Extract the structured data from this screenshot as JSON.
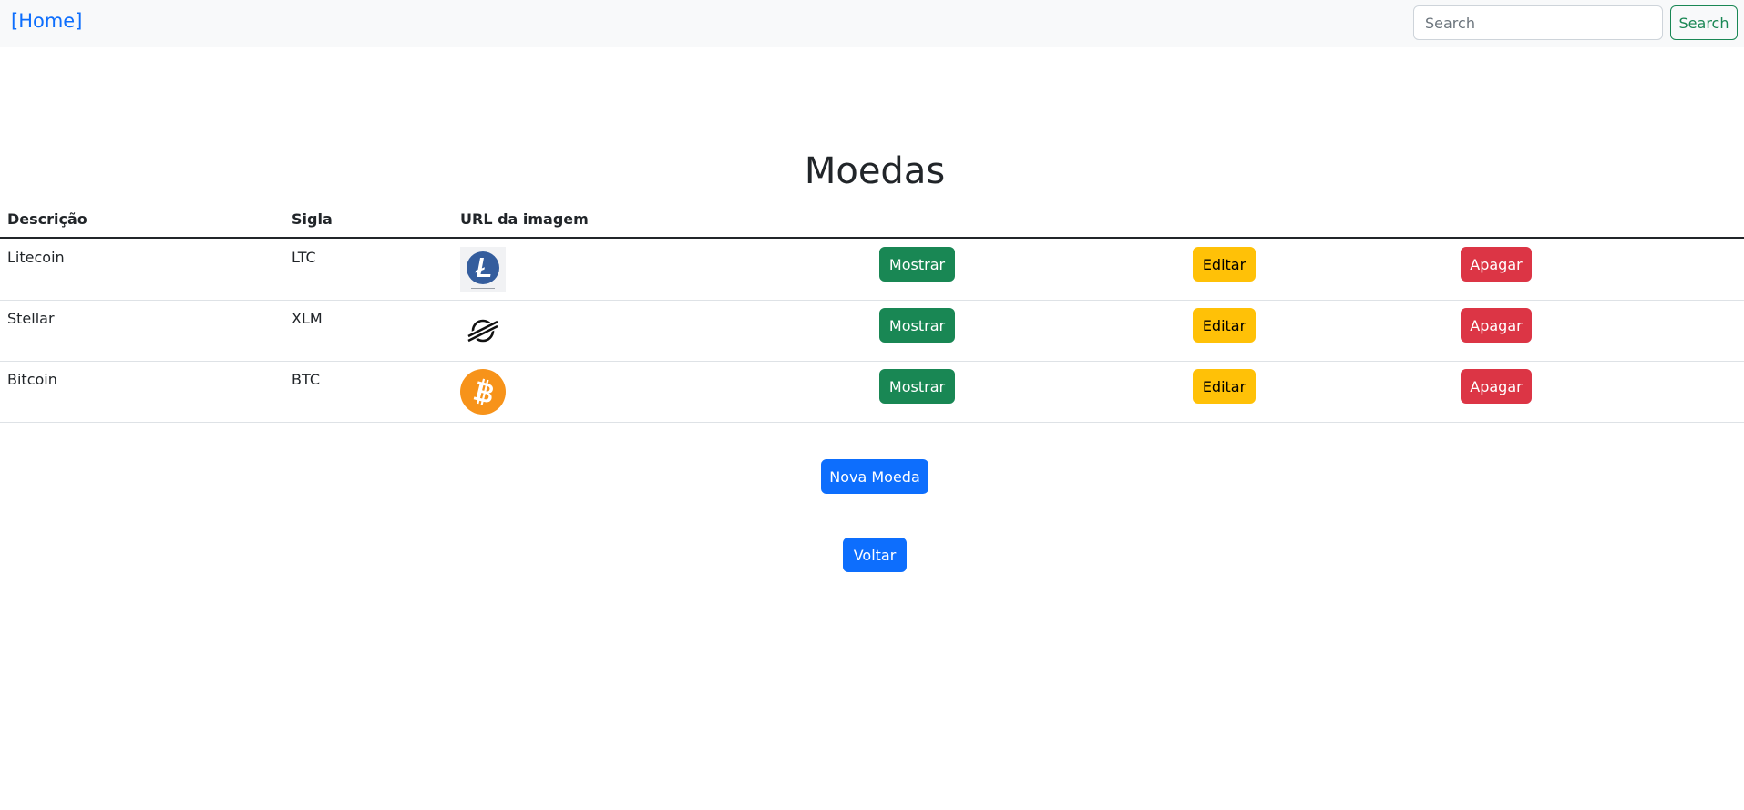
{
  "navbar": {
    "brand": "[Home]",
    "search_placeholder": "Search",
    "search_button": "Search"
  },
  "page": {
    "title": "Moedas"
  },
  "table": {
    "headers": [
      "Descrição",
      "Sigla",
      "URL da imagem"
    ],
    "rows": [
      {
        "descricao": "Litecoin",
        "sigla": "LTC",
        "icon": "litecoin-icon",
        "show": "Mostrar",
        "edit": "Editar",
        "delete": "Apagar"
      },
      {
        "descricao": "Stellar",
        "sigla": "XLM",
        "icon": "stellar-icon",
        "show": "Mostrar",
        "edit": "Editar",
        "delete": "Apagar"
      },
      {
        "descricao": "Bitcoin",
        "sigla": "BTC",
        "icon": "bitcoin-icon",
        "show": "Mostrar",
        "edit": "Editar",
        "delete": "Apagar"
      }
    ]
  },
  "actions": {
    "new_coin": "Nova Moeda",
    "back": "Voltar"
  },
  "colors": {
    "primary": "#0d6efd",
    "success": "#198754",
    "warning": "#ffc107",
    "danger": "#dc3545",
    "litecoin": "#345d9d",
    "bitcoin": "#f7931a"
  }
}
